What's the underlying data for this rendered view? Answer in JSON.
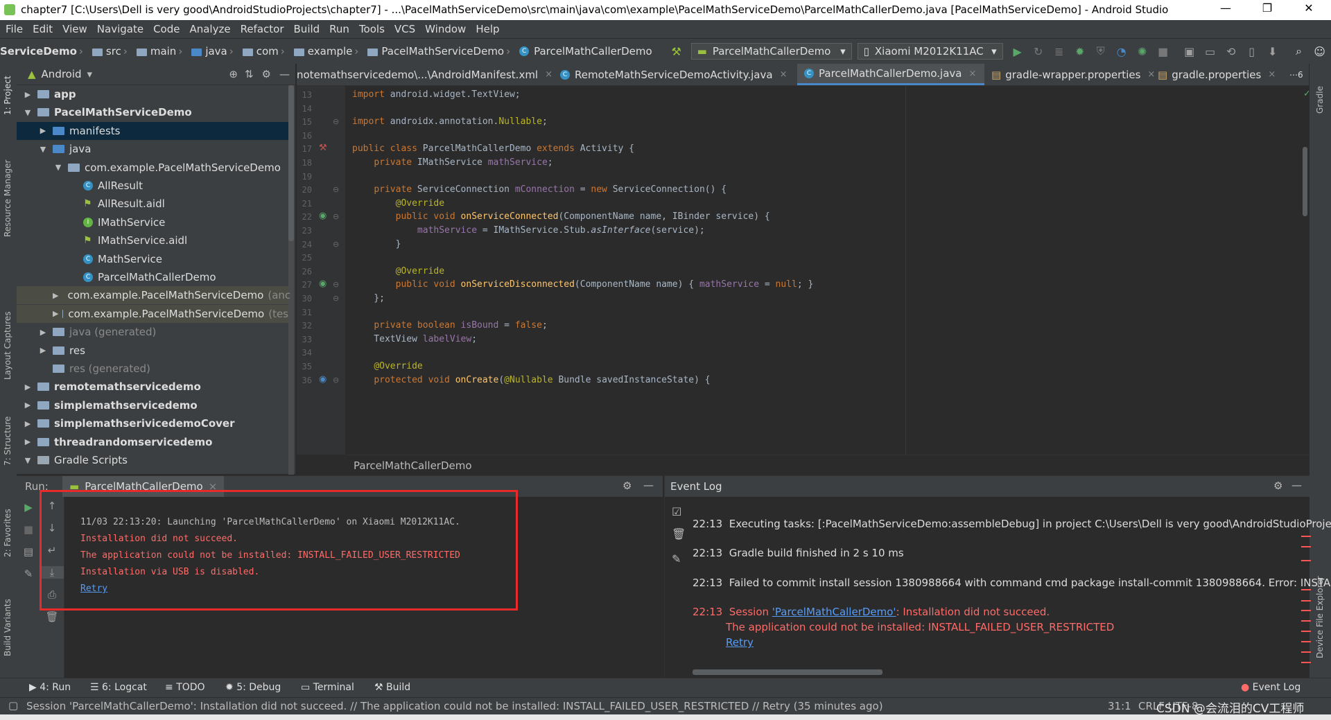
{
  "window": {
    "title": "chapter7 [C:\\Users\\Dell is very good\\AndroidStudioProjects\\chapter7] - ...\\PacelMathServiceDemo\\src\\main\\java\\com\\example\\PacelMathServiceDemo\\ParcelMathCallerDemo.java [PacelMathServiceDemo] - Android Studio",
    "minimize": "—",
    "restore": "❐",
    "close": "✕"
  },
  "menu": [
    "File",
    "Edit",
    "View",
    "Navigate",
    "Code",
    "Analyze",
    "Refactor",
    "Build",
    "Run",
    "Tools",
    "VCS",
    "Window",
    "Help"
  ],
  "navbar": {
    "crumbs": [
      "ServiceDemo",
      "src",
      "main",
      "java",
      "com",
      "example",
      "PacelMathServiceDemo",
      "ParcelMathCallerDemo"
    ],
    "run_config": "ParcelMathCallerDemo",
    "device": "Xiaomi M2012K11AC"
  },
  "project_panel": {
    "view": "Android",
    "tree": [
      {
        "label": "app",
        "level": 0,
        "arrow": "▶",
        "bold": true
      },
      {
        "label": "PacelMathServiceDemo",
        "level": 0,
        "arrow": "▼",
        "bold": true
      },
      {
        "label": "manifests",
        "level": 1,
        "arrow": "▶"
      },
      {
        "label": "java",
        "level": 1,
        "arrow": "▼"
      },
      {
        "label": "com.example.PacelMathServiceDemo",
        "level": 2,
        "arrow": "▼"
      },
      {
        "label": "AllResult",
        "level": 3
      },
      {
        "label": "AllResult.aidl",
        "level": 3
      },
      {
        "label": "IMathService",
        "level": 3
      },
      {
        "label": "IMathService.aidl",
        "level": 3
      },
      {
        "label": "MathService",
        "level": 3
      },
      {
        "label": "ParcelMathCallerDemo",
        "level": 3
      },
      {
        "label": "com.example.PacelMathServiceDemo",
        "suffix": "(anc",
        "level": 2,
        "arrow": "▶"
      },
      {
        "label": "com.example.PacelMathServiceDemo",
        "suffix": "(tes",
        "level": 2,
        "arrow": "▶"
      },
      {
        "label": "java (generated)",
        "level": 1,
        "arrow": "▶"
      },
      {
        "label": "res",
        "level": 1,
        "arrow": "▶"
      },
      {
        "label": "res (generated)",
        "level": 1
      },
      {
        "label": "remotemathservicedemo",
        "level": 0,
        "arrow": "▶",
        "bold": true
      },
      {
        "label": "simplemathservicedemo",
        "level": 0,
        "arrow": "▶",
        "bold": true
      },
      {
        "label": "simplemathserivicedemoCover",
        "level": 0,
        "arrow": "▶",
        "bold": true
      },
      {
        "label": "threadrandomservicedemo",
        "level": 0,
        "arrow": "▶",
        "bold": true
      },
      {
        "label": "Gradle Scripts",
        "level": 0,
        "arrow": "▼"
      }
    ]
  },
  "left_tools": [
    "1: Project",
    "Resource Manager",
    "Layout Captures",
    "7: Structure",
    "2: Favorites",
    "Build Variants"
  ],
  "right_tools": [
    "Gradle",
    "Device File Explorer"
  ],
  "tabs": [
    {
      "label": "notemathservicedemo\\...\\AndroidManifest.xml"
    },
    {
      "label": "RemoteMathServiceDemoActivity.java"
    },
    {
      "label": "ParcelMathCallerDemo.java",
      "active": true
    },
    {
      "label": "gradle-wrapper.properties"
    },
    {
      "label": "gradle.properties"
    }
  ],
  "tab_overflow": "⋯6",
  "editor": {
    "lines": [
      {
        "n": "13",
        "html": "<span class=\"kw\">import</span> android.widget.TextView;"
      },
      {
        "n": "14",
        "html": ""
      },
      {
        "n": "15",
        "html": "<span class=\"kw\">import</span> androidx.annotation.<span class=\"an\">Nullable</span>;"
      },
      {
        "n": "16",
        "html": ""
      },
      {
        "n": "17",
        "html": "<span class=\"kw\">public class</span> ParcelMathCallerDemo <span class=\"kw\">extends</span> Activity {"
      },
      {
        "n": "18",
        "html": "    <span class=\"kw\">private</span> IMathService <span class=\"fld\">mathService</span>;"
      },
      {
        "n": "19",
        "html": ""
      },
      {
        "n": "20",
        "html": "    <span class=\"kw\">private</span> ServiceConnection <span class=\"fld\">mConnection</span> = <span class=\"kw\">new</span> ServiceConnection() {"
      },
      {
        "n": "21",
        "html": "        <span class=\"an\">@Override</span>"
      },
      {
        "n": "22",
        "html": "        <span class=\"kw\">public void</span> <span class=\"fn\">onServiceConnected</span>(ComponentName name, IBinder service) {"
      },
      {
        "n": "23",
        "html": "            <span class=\"fld\">mathService</span> = IMathService.Stub.<span class=\"it\">asInterface</span>(service);"
      },
      {
        "n": "24",
        "html": "        }"
      },
      {
        "n": "25",
        "html": ""
      },
      {
        "n": "26",
        "html": "        <span class=\"an\">@Override</span>"
      },
      {
        "n": "27",
        "html": "        <span class=\"kw\">public void</span> <span class=\"fn\">onServiceDisconnected</span>(ComponentName name) { <span class=\"fld\">mathService</span> = <span class=\"kw\">null</span>; }"
      },
      {
        "n": "30",
        "html": "    };"
      },
      {
        "n": "31",
        "html": ""
      },
      {
        "n": "32",
        "html": "    <span class=\"kw\">private boolean</span> <span class=\"fld\">isBound</span> = <span class=\"kw\">false</span>;"
      },
      {
        "n": "33",
        "html": "    TextView <span class=\"fld\">labelView</span>;"
      },
      {
        "n": "34",
        "html": ""
      },
      {
        "n": "35",
        "html": "    <span class=\"an\">@Override</span>"
      },
      {
        "n": "36",
        "html": "    <span class=\"kw\">protected void</span> <span class=\"fn\">onCreate</span>(<span class=\"an\">@Nullable</span> Bundle savedInstanceState) {"
      }
    ],
    "breadcrumb": "ParcelMathCallerDemo"
  },
  "run_panel": {
    "label": "Run:",
    "tab": "ParcelMathCallerDemo",
    "output": [
      {
        "text": "11/03 22:13:20: Launching 'ParcelMathCallerDemo' on Xiaomi M2012K11AC.",
        "type": "normal"
      },
      {
        "text": "Installation did not succeed.",
        "type": "error"
      },
      {
        "text": "The application could not be installed: INSTALL_FAILED_USER_RESTRICTED",
        "type": "error"
      },
      {
        "text": "Installation via USB is disabled.",
        "type": "error"
      },
      {
        "text": "Retry",
        "type": "link"
      }
    ]
  },
  "event_log": {
    "title": "Event Log",
    "entries": [
      {
        "time": "22:13",
        "text": "Executing tasks: [:PacelMathServiceDemo:assembleDebug] in project C:\\Users\\Dell is very good\\AndroidStudioProje"
      },
      {
        "time": "22:13",
        "text": "Gradle build finished in 2 s 10 ms"
      },
      {
        "time": "22:13",
        "text": "Failed to commit install session 1380988664 with command cmd package install-commit 1380988664. Error: INSTALL"
      }
    ],
    "error_entry": {
      "time": "22:13",
      "prefix": "Session ",
      "link": "'ParcelMathCallerDemo'",
      "suffix": ": Installation did not succeed.",
      "line2": "The application could not be installed: INSTALL_FAILED_USER_RESTRICTED",
      "retry": "Retry"
    }
  },
  "bottom_tabs": [
    {
      "label": "4: Run"
    },
    {
      "label": "6: Logcat"
    },
    {
      "label": "TODO"
    },
    {
      "label": "5: Debug"
    },
    {
      "label": "Terminal"
    },
    {
      "label": "Build"
    }
  ],
  "event_log_tab": "Event Log",
  "status": {
    "message": "Session 'ParcelMathCallerDemo': Installation did not succeed. // The application could not be installed: INSTALL_FAILED_USER_RESTRICTED // Retry (35 minutes ago)",
    "position": "31:1",
    "encoding": "CRLF  UTF-8",
    "watermark": "CSDN @会流泪的CV工程师"
  },
  "colors": {
    "accent": "#4a88c7",
    "error": "#ff6b68",
    "link": "#589df6",
    "highlight_box": "#e82a2a"
  }
}
